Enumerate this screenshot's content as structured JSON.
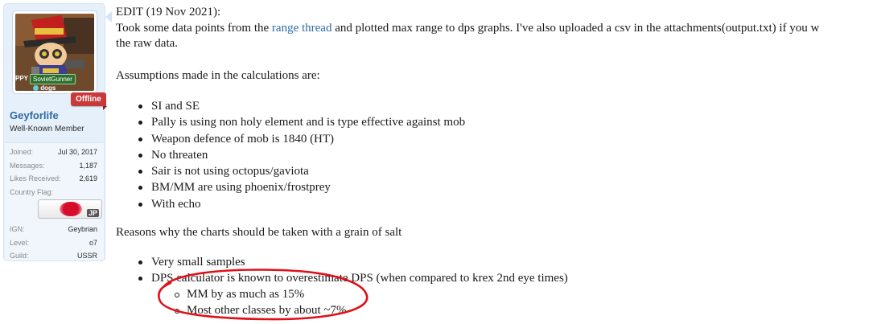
{
  "sidebar": {
    "avatar_overlay": {
      "partial_prefix": "PPY",
      "tag_name": "SovietGunner",
      "guild": "dogs"
    },
    "status_badge": "Offline",
    "username": "Geyforlife",
    "user_title": "Well-Known Member",
    "stats": {
      "joined_label": "Joined:",
      "joined_value": "Jul 30, 2017",
      "messages_label": "Messages:",
      "messages_value": "1,187",
      "likes_label": "Likes Received:",
      "likes_value": "2,619",
      "country_label": "Country Flag:",
      "country_code": "JP",
      "ign_label": "IGN:",
      "ign_value": "Geybrian",
      "level_label": "Level:",
      "level_value": "o7",
      "guild_label": "Guild:",
      "guild_value": "USSR"
    }
  },
  "post": {
    "edit_line": "EDIT (19 Nov 2021):",
    "intro_before_link": "Took some data points from the ",
    "link_text": "range thread",
    "intro_after_link": " and plotted max range to dps graphs. I've also uploaded a csv in the attachments(output.txt) if you w",
    "intro_line2": "the raw data.",
    "assumptions_heading": "Assumptions made in the calculations are:",
    "assumptions": [
      "SI and SE",
      "Pally is using non holy element and is type effective against mob",
      "Weapon defence of mob is 1840 (HT)",
      "No threaten",
      "Sair is not using octopus/gaviota",
      "BM/MM are using phoenix/frostprey",
      "With echo"
    ],
    "reasons_heading": "Reasons why the charts should be taken with a grain of salt",
    "reasons": [
      "Very small samples",
      "DPS calculator is known to overestimate DPS (when compared to krex 2nd eye times)"
    ],
    "subreasons": [
      "MM by as much as 15%",
      "Most other classes by about ~7%"
    ]
  },
  "colors": {
    "sidebar_bg": "#e6f0fa",
    "link": "#2f6aa6",
    "offline_badge": "#c83a3a",
    "annotation_circle": "#e0101a"
  }
}
